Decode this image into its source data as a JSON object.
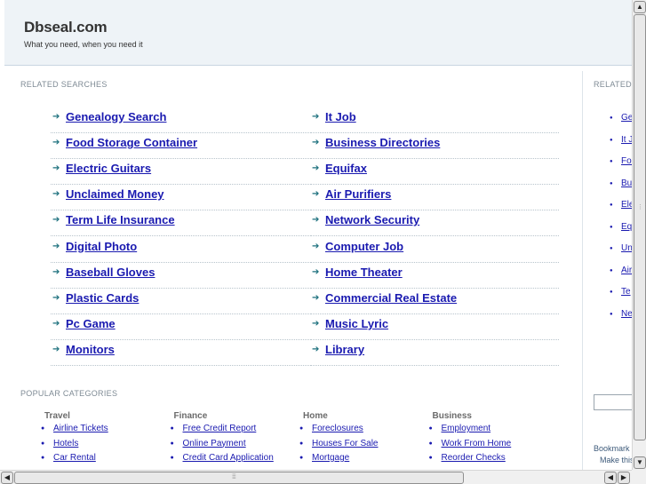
{
  "header": {
    "title": "Dbseal.com",
    "tagline": "What you need, when you need it"
  },
  "related": {
    "label": "RELATED SEARCHES",
    "left": [
      "Genealogy Search",
      "Food Storage Container",
      "Electric Guitars",
      "Unclaimed Money",
      "Term Life Insurance",
      "Digital Photo",
      "Baseball Gloves",
      "Plastic Cards",
      "Pc Game",
      "Monitors"
    ],
    "right": [
      "It Job",
      "Business Directories",
      "Equifax",
      "Air Purifiers",
      "Network Security",
      "Computer Job",
      "Home Theater",
      "Commercial Real Estate",
      "Music Lyric",
      "Library"
    ]
  },
  "popular": {
    "label": "POPULAR CATEGORIES",
    "categories": [
      {
        "title": "Travel",
        "items": [
          "Airline Tickets",
          "Hotels",
          "Car Rental"
        ]
      },
      {
        "title": "Finance",
        "items": [
          "Free Credit Report",
          "Online Payment",
          "Credit Card Application"
        ]
      },
      {
        "title": "Home",
        "items": [
          "Foreclosures",
          "Houses For Sale",
          "Mortgage"
        ]
      },
      {
        "title": "Business",
        "items": [
          "Employment",
          "Work From Home",
          "Reorder Checks"
        ]
      }
    ]
  },
  "sidebar": {
    "label": "RELATED",
    "items": [
      "Ge",
      "It J",
      "Foo",
      "Bus",
      "Ele",
      "Equ",
      "Un",
      "Air",
      "Te",
      "Ne"
    ],
    "bookmark_line1": "Bookmark",
    "bookmark_line2": "Make this"
  },
  "icons": {
    "arrow": "arrow-right-icon",
    "bullet": "bullet-icon"
  },
  "colors": {
    "link": "#1a1ab0",
    "arrow": "#1b6f7c",
    "header_bg": "#eef3f7"
  }
}
